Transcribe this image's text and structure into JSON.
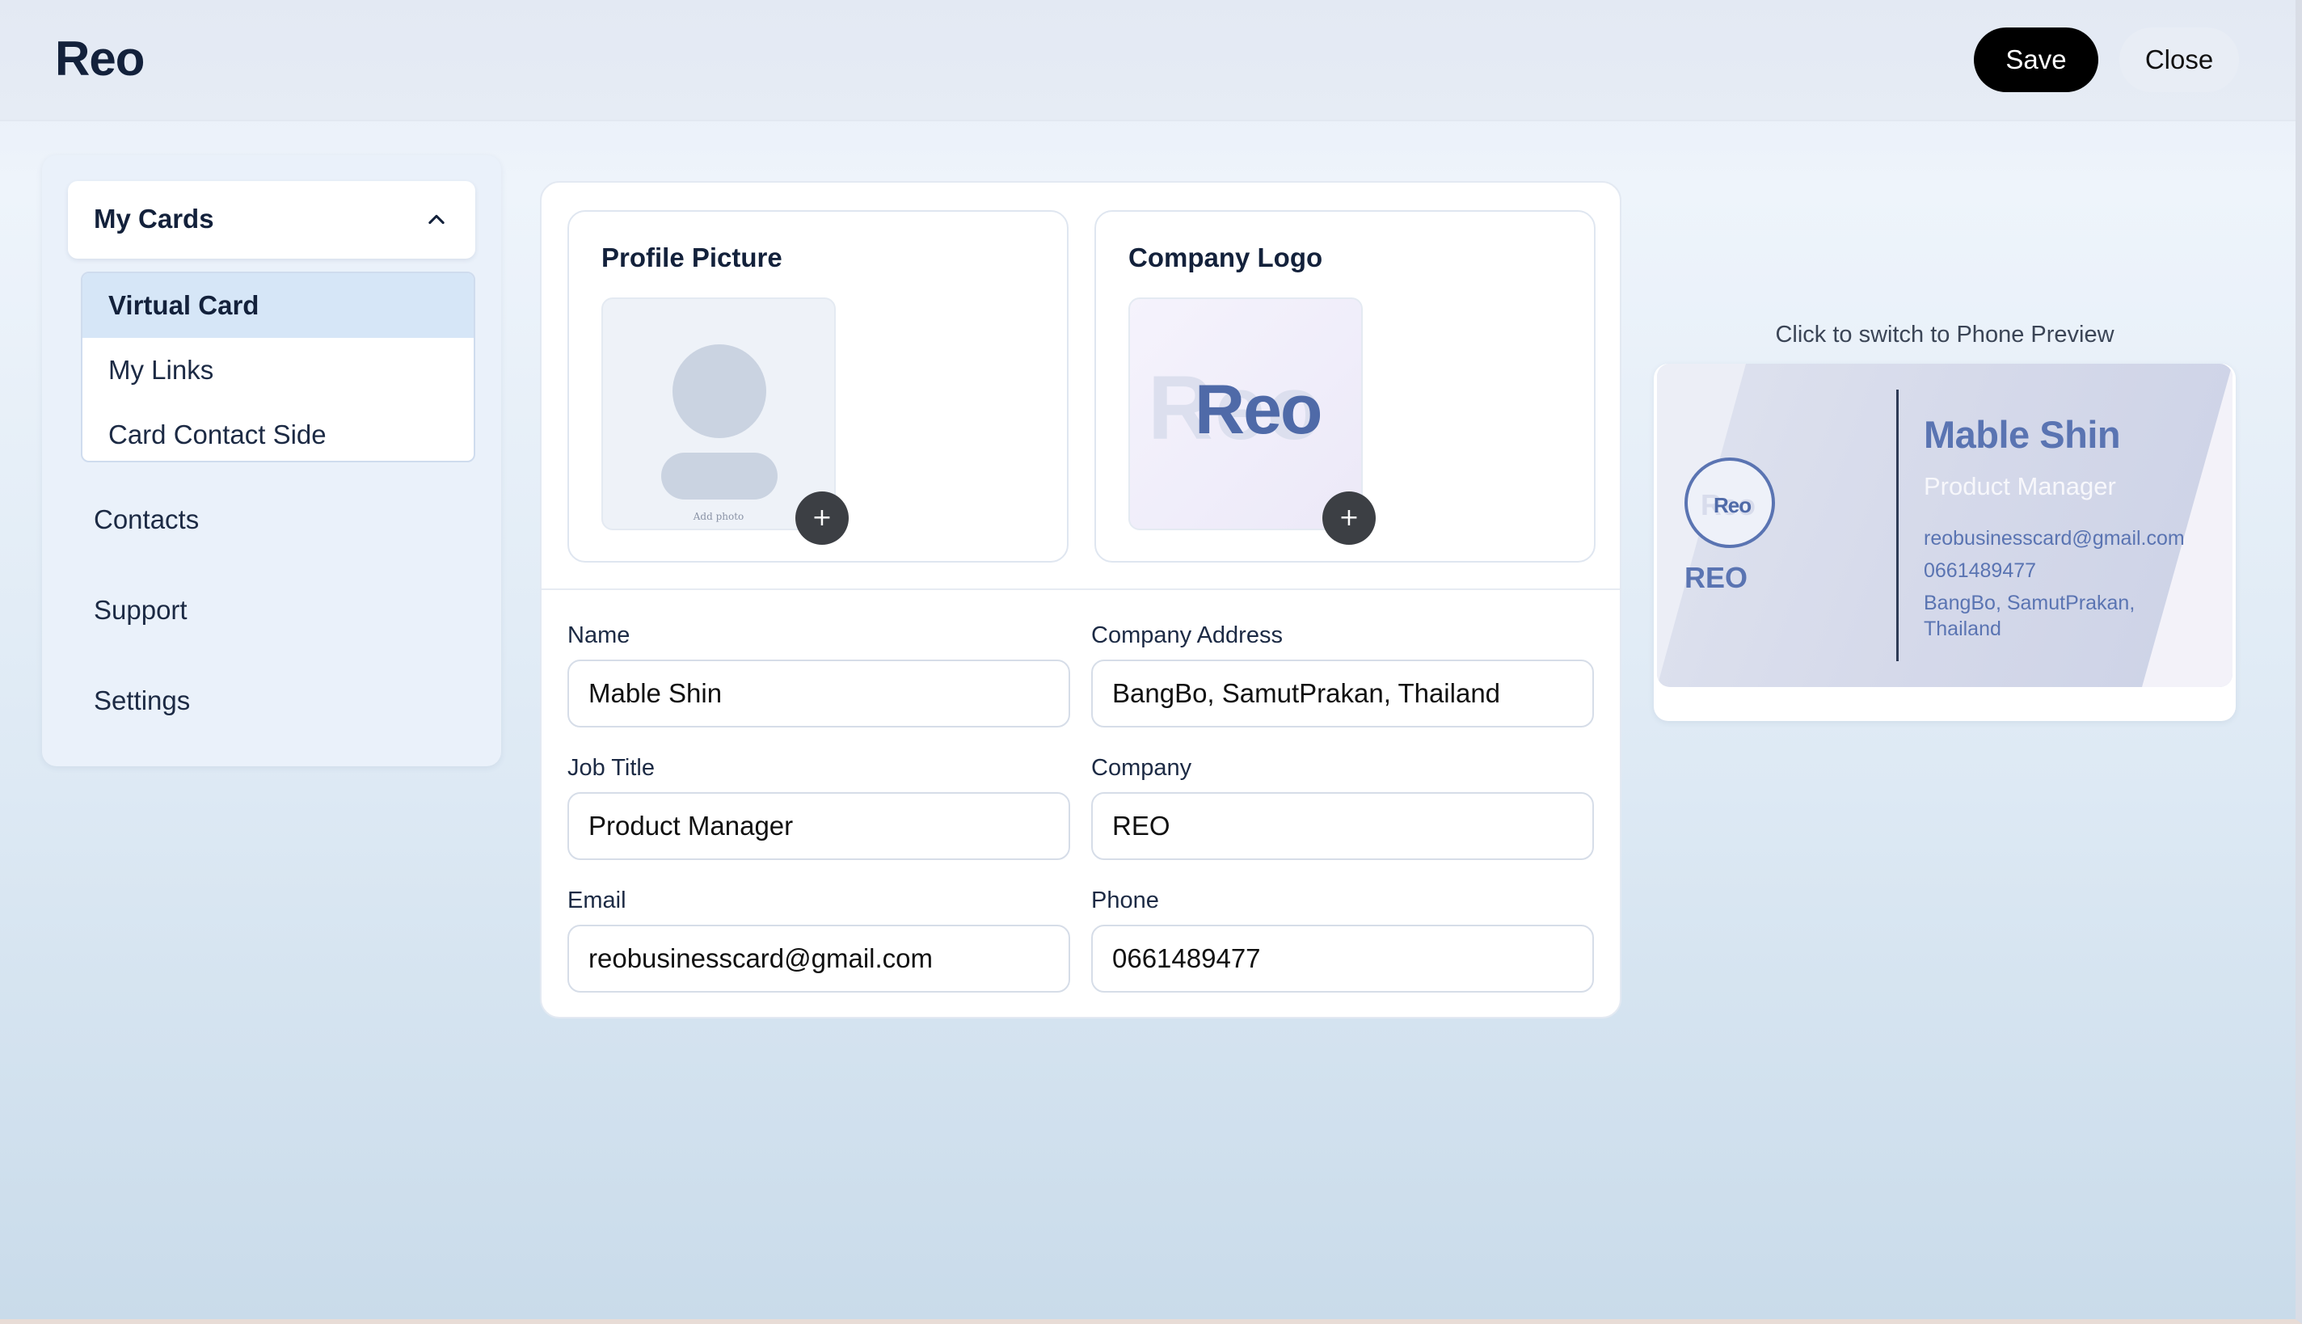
{
  "app": {
    "brand": "Reo"
  },
  "header": {
    "save_label": "Save",
    "close_label": "Close"
  },
  "sidebar": {
    "section": "My Cards",
    "subitems": [
      "Virtual Card",
      "My Links",
      "Card Contact Side"
    ],
    "items": [
      "Contacts",
      "Support",
      "Settings"
    ]
  },
  "uploads": {
    "profile_title": "Profile Picture",
    "profile_placeholder": "Add photo",
    "logo_title": "Company Logo",
    "logo_text": "Reo",
    "logo_ghost": "Reo",
    "add_symbol": "+"
  },
  "form": {
    "name_label": "Name",
    "name_value": "Mable Shin",
    "address_label": "Company Address",
    "address_value": "BangBo, SamutPrakan, Thailand",
    "job_label": "Job Title",
    "job_value": "Product Manager",
    "company_label": "Company",
    "company_value": "REO",
    "email_label": "Email",
    "email_value": "reobusinesscard@gmail.com",
    "phone_label": "Phone",
    "phone_value": "0661489477"
  },
  "preview": {
    "caption": "Click to switch to Phone Preview",
    "logo_text": "Reo",
    "company": "REO",
    "name": "Mable Shin",
    "title": "Product Manager",
    "email": "reobusinesscard@gmail.com",
    "phone": "0661489477",
    "address_line1": "BangBo, SamutPrakan,",
    "address_line2": "Thailand"
  },
  "colors": {
    "accent": "#5a74b2",
    "primary_button": "#000000",
    "active_nav": "#d6e6f7"
  },
  "icons": {
    "section_toggle": "chevron-up-icon",
    "upload": "plus-icon"
  }
}
